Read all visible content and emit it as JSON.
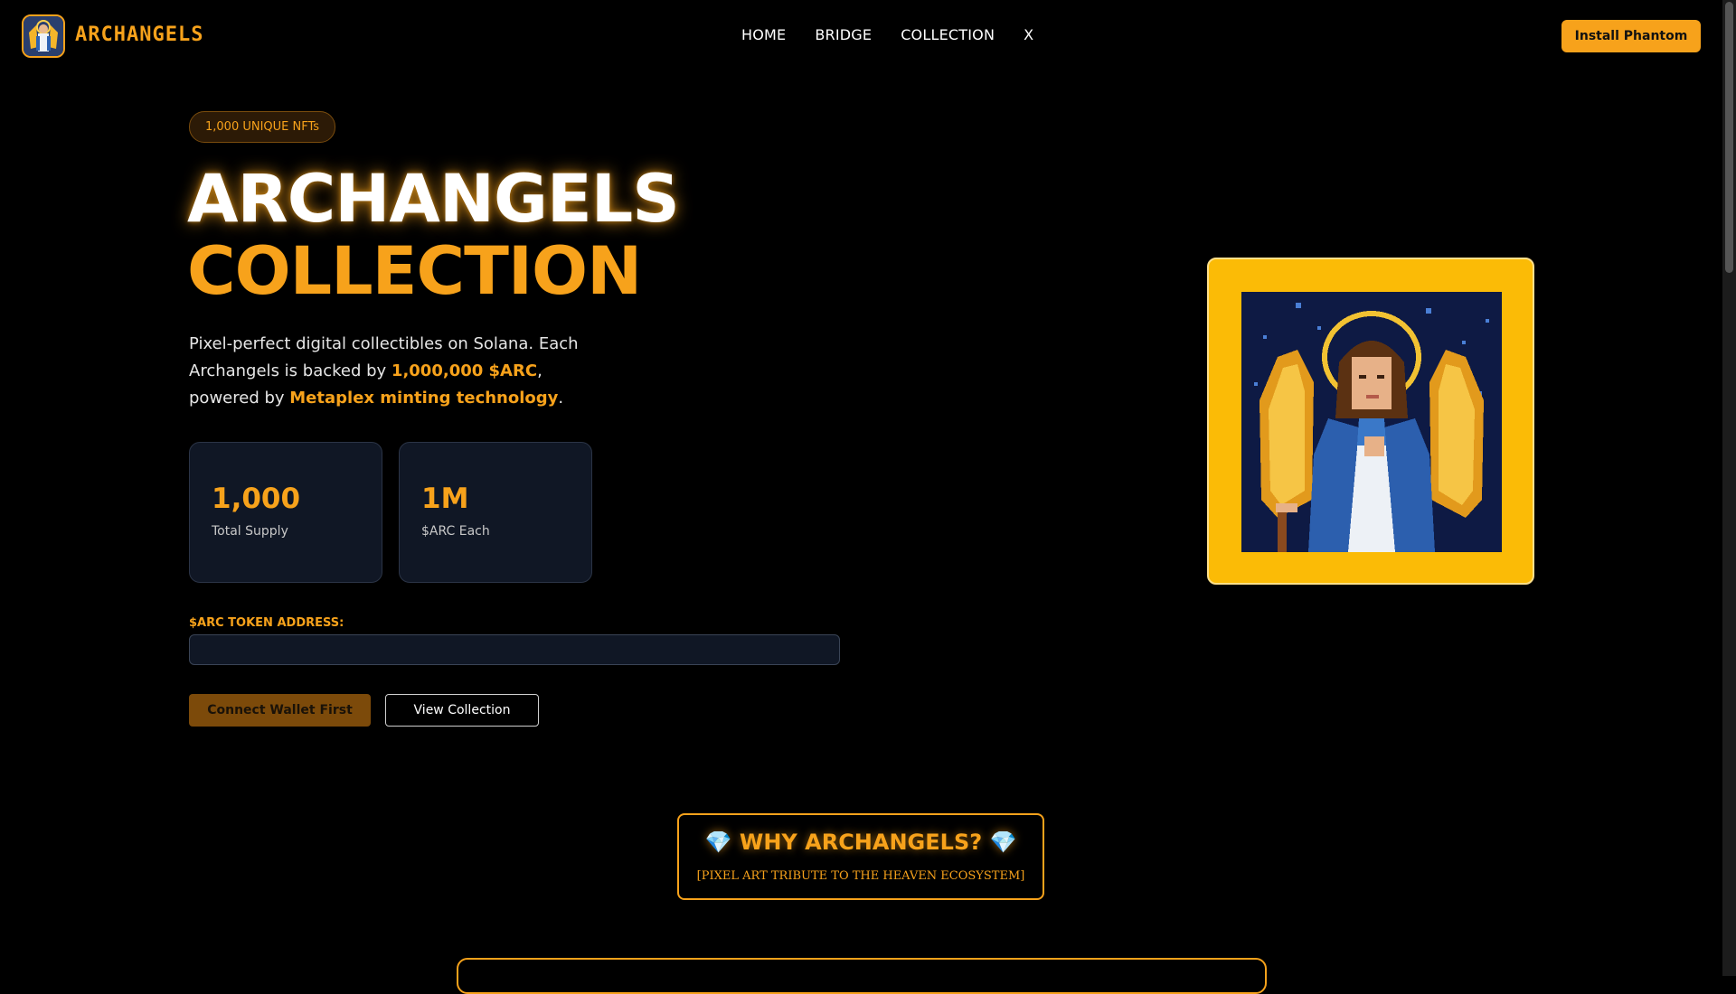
{
  "header": {
    "logo_text": "ARCHANGELS",
    "nav": [
      "HOME",
      "BRIDGE",
      "COLLECTION",
      "X"
    ],
    "install_label": "Install Phantom"
  },
  "hero": {
    "badge": "1,000 UNIQUE NFTs",
    "title_line1": "ARCHANGELS",
    "title_line2": "COLLECTION",
    "desc_part1": "Pixel-perfect digital collectibles on Solana. Each Archangels is backed by ",
    "desc_highlight1": "1,000,000 $ARC",
    "desc_part2": ", powered by ",
    "desc_highlight2": "Metaplex minting technology",
    "desc_part3": ".",
    "stats": [
      {
        "value": "1,000",
        "label": "Total Supply"
      },
      {
        "value": "1M",
        "label": "$ARC Each"
      }
    ],
    "address_label": "$ARC TOKEN ADDRESS:",
    "address_value": "",
    "connect_label": "Connect Wallet First",
    "view_label": "View Collection"
  },
  "why": {
    "title": "💎 WHY ARCHANGELS? 💎",
    "subtitle": "[PIXEL ART TRIBUTE TO THE HEAVEN ECOSYSTEM]"
  },
  "colors": {
    "accent": "#f7a21b",
    "frame": "#fbbb06",
    "card_bg": "#101725",
    "background": "#000000"
  },
  "icons": [
    "archangel-logo-icon",
    "archangel-pixel-art"
  ]
}
